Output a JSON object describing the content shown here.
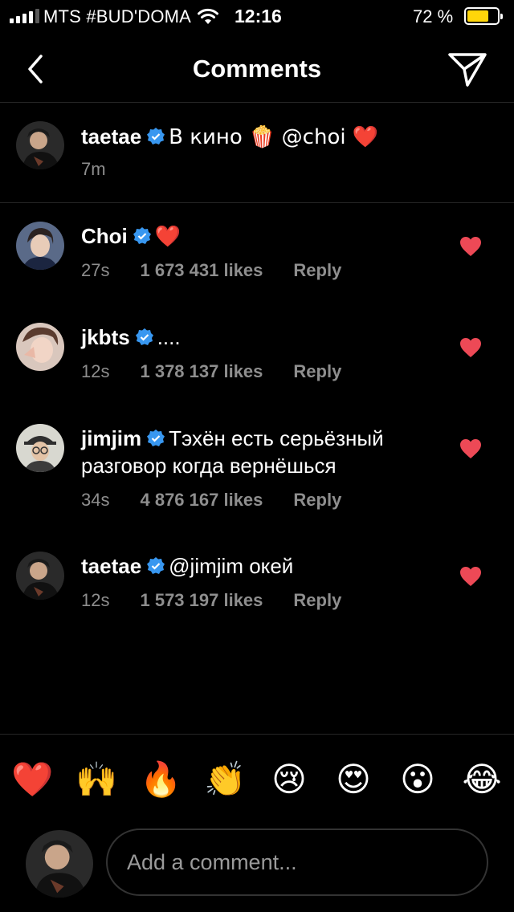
{
  "status_bar": {
    "carrier": "MTS #BUD'DOMA",
    "time": "12:16",
    "battery_percent": "72 %",
    "battery_level": 0.72,
    "battery_color": "#ffd60a"
  },
  "nav": {
    "title": "Comments",
    "back_icon": "chevron-left-icon",
    "send_icon": "paper-plane-icon"
  },
  "caption": {
    "username": "taetae",
    "text": "В кино 🍿 @choi ❤️",
    "time": "7m"
  },
  "comments": [
    {
      "username": "Choi",
      "text": "❤️",
      "time": "27s",
      "likes": "1 673 431 likes",
      "reply": "Reply"
    },
    {
      "username": "jkbts",
      "text": "....",
      "time": "12s",
      "likes": "1 378 137 likes",
      "reply": "Reply"
    },
    {
      "username": "jimjim",
      "text": "Тэхён есть серьёзный",
      "text_line2": "разговор когда вернёшься",
      "time": "34s",
      "likes": "4 876 167 likes",
      "reply": "Reply"
    },
    {
      "username": "taetae",
      "text": "@jimjim окей",
      "time": "12s",
      "likes": "1 573 197 likes",
      "reply": "Reply"
    }
  ],
  "quick_reactions": [
    "❤️",
    "🙌",
    "🔥",
    "👏",
    "😢",
    "😍",
    "😮",
    "😂"
  ],
  "composer": {
    "placeholder": "Add a comment..."
  },
  "colors": {
    "verified": "#3897f0",
    "like_heart": "#ed4956",
    "meta_text": "#8e8e8e",
    "divider": "#262626"
  }
}
